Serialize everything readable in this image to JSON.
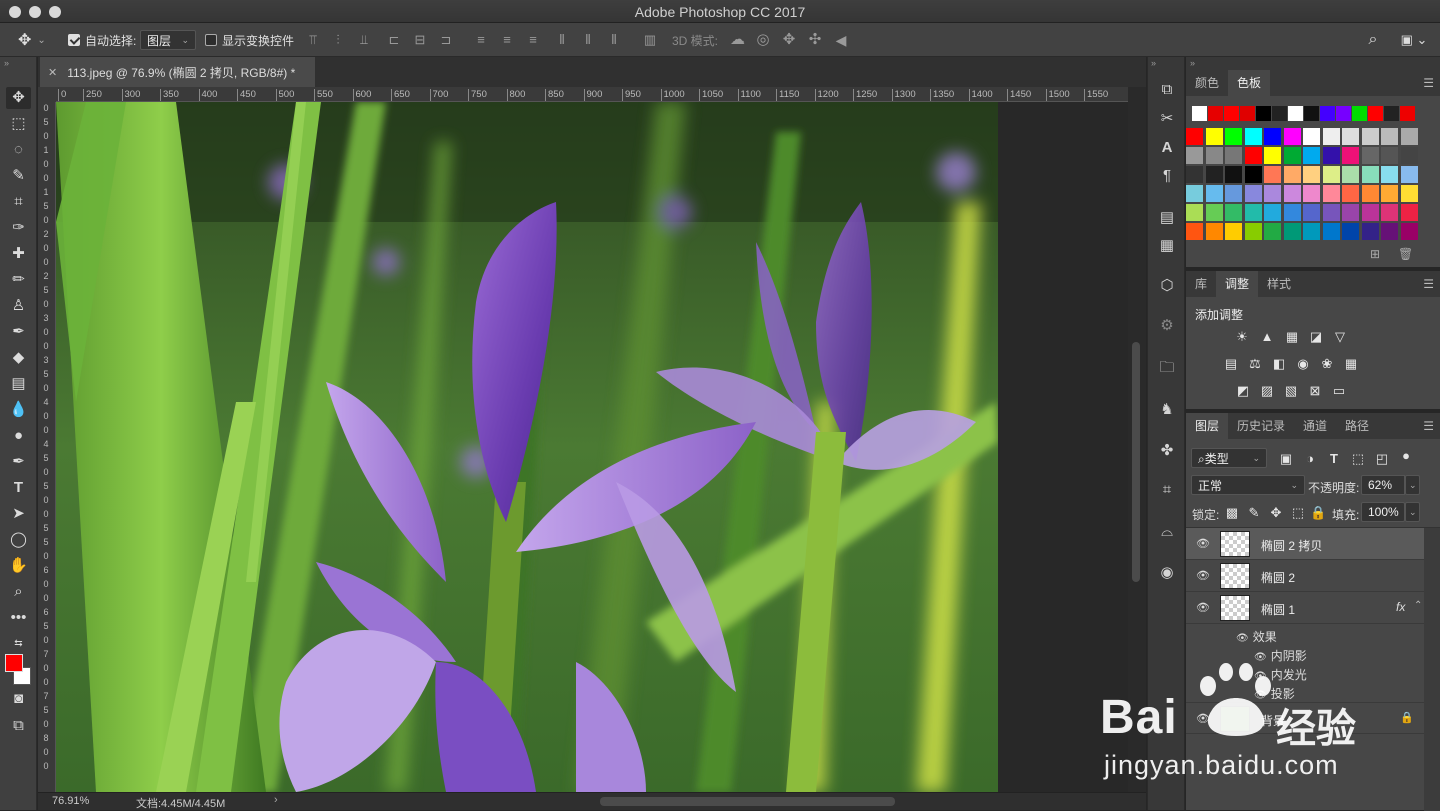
{
  "window": {
    "title": "Adobe Photoshop CC 2017"
  },
  "options": {
    "auto_select_label": "自动选择:",
    "auto_select_value": "图层",
    "show_transform_label": "显示变换控件",
    "mode_3d_label": "3D 模式:"
  },
  "document": {
    "tab_title": "113.jpeg @ 76.9% (椭圆 2 拷贝, RGB/8#) *",
    "ruler_h": [
      "0",
      "250",
      "300",
      "350",
      "400",
      "450",
      "500",
      "550",
      "600",
      "650",
      "700",
      "750",
      "800",
      "850",
      "900",
      "950",
      "1000",
      "1050",
      "1100",
      "1150",
      "1200",
      "1250",
      "1300",
      "1350",
      "1400",
      "1450",
      "1500",
      "1550"
    ],
    "ruler_v": [
      "0",
      "5",
      "0",
      "1",
      "0",
      "0",
      "1",
      "5",
      "0",
      "2",
      "0",
      "0",
      "2",
      "5",
      "0",
      "3",
      "0",
      "0",
      "3",
      "5",
      "0",
      "4",
      "0",
      "0",
      "4",
      "5",
      "0",
      "5",
      "0",
      "0",
      "5",
      "5",
      "0",
      "6",
      "0",
      "0",
      "6",
      "5",
      "0",
      "7",
      "0",
      "0",
      "7",
      "5",
      "0",
      "8",
      "0",
      "0"
    ]
  },
  "status": {
    "zoom": "76.91%",
    "doc_size": "文档:4.45M/4.45M"
  },
  "colors": {
    "foreground": "#ff0000",
    "background": "#ffffff",
    "accent_panel": "#474747"
  },
  "panel_swatches": {
    "tabs": [
      "颜色",
      "色板"
    ],
    "active_tab": "色板"
  },
  "panel_adjust": {
    "tabs": [
      "库",
      "调整",
      "样式"
    ],
    "active_tab": "调整",
    "heading": "添加调整"
  },
  "panel_layers": {
    "tabs": [
      "图层",
      "历史记录",
      "通道",
      "路径"
    ],
    "active_tab": "图层",
    "filter_kind": "类型",
    "blend_mode": "正常",
    "opacity_label": "不透明度:",
    "opacity_value": "62%",
    "lock_label": "锁定:",
    "fill_label": "填充:",
    "fill_value": "100%",
    "layers": [
      {
        "name": "椭圆 2 拷贝",
        "selected": true
      },
      {
        "name": "椭圆 2",
        "selected": false
      },
      {
        "name": "椭圆 1",
        "selected": false,
        "fx": "fx"
      }
    ],
    "effects_label": "效果",
    "effects": [
      "内阴影",
      "内发光",
      "投影"
    ],
    "background_layer": "背景"
  },
  "watermark": {
    "brand": "Bai",
    "brand2": "经验",
    "url": "jingyan.baidu.com"
  }
}
